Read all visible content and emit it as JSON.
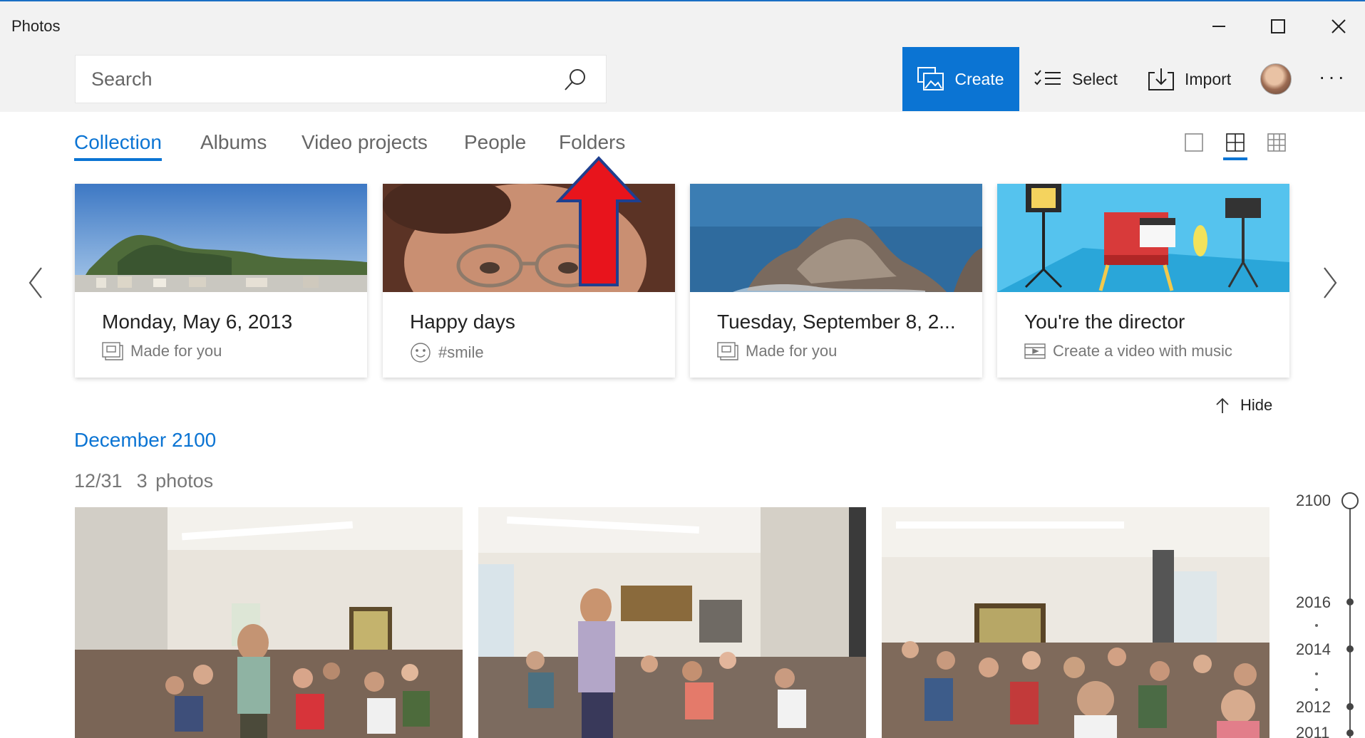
{
  "window": {
    "title": "Photos",
    "controls": {
      "minimize": "minimize-icon",
      "maximize": "maximize-icon",
      "close": "close-icon"
    }
  },
  "search": {
    "placeholder": "Search",
    "value": ""
  },
  "commands": {
    "create": "Create",
    "select": "Select",
    "import": "Import",
    "more": "···"
  },
  "tabs": [
    {
      "label": "Collection",
      "active": true
    },
    {
      "label": "Albums",
      "active": false
    },
    {
      "label": "Video projects",
      "active": false
    },
    {
      "label": "People",
      "active": false
    },
    {
      "label": "Folders",
      "active": false
    }
  ],
  "view_modes": [
    "single",
    "medium-grid",
    "small-grid"
  ],
  "cards": [
    {
      "title": "Monday, May 6, 2013",
      "subtitle": "Made for you",
      "icon": "album-icon"
    },
    {
      "title": "Happy days",
      "subtitle": "#smile",
      "icon": "smiley-icon"
    },
    {
      "title": "Tuesday, September 8, 2...",
      "subtitle": "Made for you",
      "icon": "album-icon"
    },
    {
      "title": "You're the director",
      "subtitle": "Create a video with music",
      "icon": "film-icon"
    }
  ],
  "hide_label": "Hide",
  "section": {
    "month": "December 2100",
    "date": "12/31",
    "count": "3 photos"
  },
  "timeline": {
    "years": [
      "2100",
      "2016",
      "2014",
      "2012",
      "2011"
    ]
  },
  "colors": {
    "accent": "#0b74d3",
    "annotation_arrow": "#e8141c"
  }
}
